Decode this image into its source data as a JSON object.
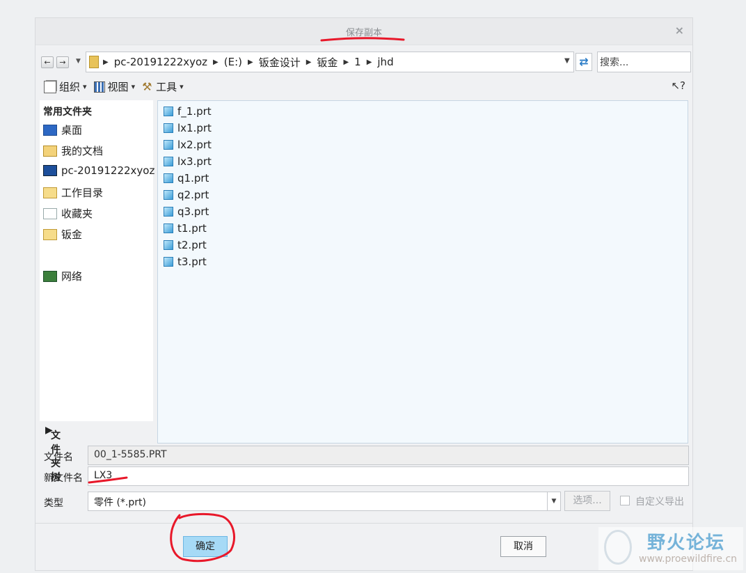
{
  "dialog": {
    "title": "保存副本",
    "close_label": "×"
  },
  "nav": {
    "back_label": "←",
    "forward_label": "→",
    "breadcrumb": [
      "pc-20191222xyoz",
      "(E:)",
      "钣金设计",
      "钣金",
      "1",
      "jhd"
    ],
    "search_placeholder": "搜索..."
  },
  "toolbar": {
    "organize": "组织",
    "view": "视图",
    "tools": "工具"
  },
  "sidebar": {
    "heading": "常用文件夹",
    "items": [
      {
        "label": "桌面",
        "icon": "desktop-icon"
      },
      {
        "label": "我的文档",
        "icon": "documents-icon"
      },
      {
        "label": "pc-20191222xyoz",
        "icon": "computer-icon"
      },
      {
        "label": "工作目录",
        "icon": "working-directory-icon"
      },
      {
        "label": "收藏夹",
        "icon": "favorites-icon"
      },
      {
        "label": "钣金",
        "icon": "folder-icon"
      },
      {
        "label": "网络",
        "icon": "network-icon"
      }
    ],
    "tree_label": "文件夹树"
  },
  "files": [
    "f_1.prt",
    "lx1.prt",
    "lx2.prt",
    "lx3.prt",
    "q1.prt",
    "q2.prt",
    "q3.prt",
    "t1.prt",
    "t2.prt",
    "t3.prt"
  ],
  "form": {
    "filename_label": "文件名",
    "filename_value": "00_1-5585.PRT",
    "newname_label": "新文件名",
    "newname_value": "LX3",
    "type_label": "类型",
    "type_value": "零件 (*.prt)",
    "options_label": "选项...",
    "custom_export_label": "自定义导出"
  },
  "buttons": {
    "ok": "确定",
    "cancel": "取消"
  },
  "watermark": {
    "title": "野火论坛",
    "url": "www.proewildfire.cn"
  },
  "colors": {
    "ok_button": "#a6daf6",
    "annotation_red": "#e8182a",
    "file_list_bg": "#f3f9fd"
  }
}
